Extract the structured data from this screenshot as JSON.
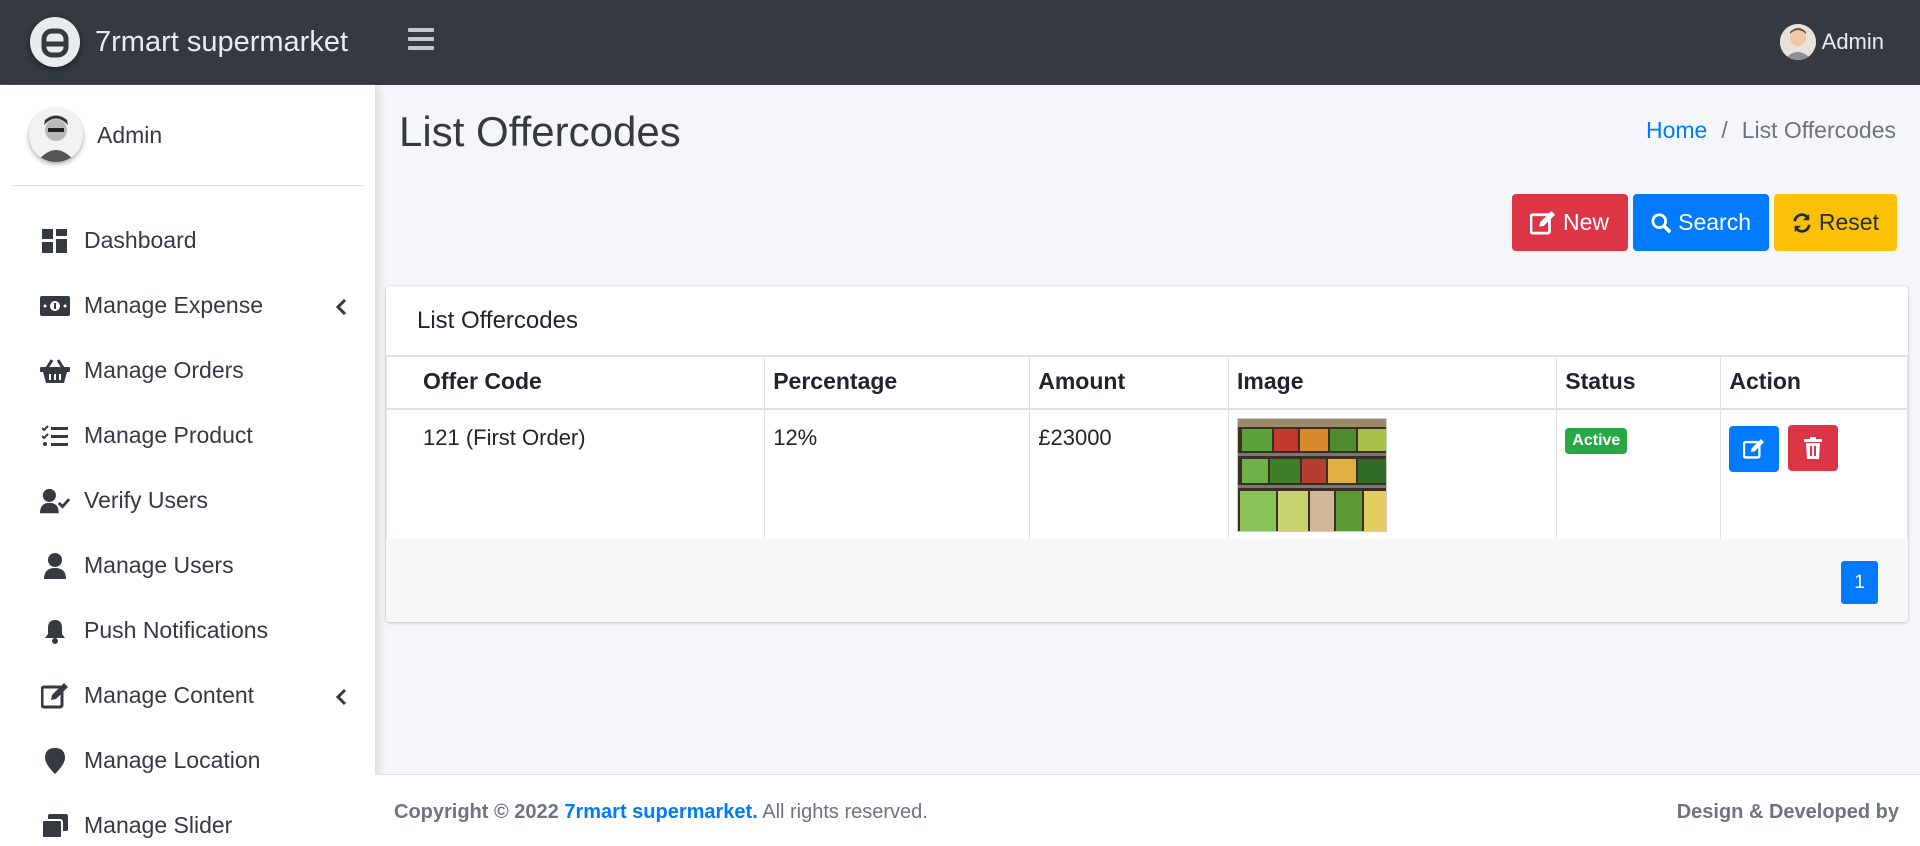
{
  "brand": {
    "name": "7rmart supermarket"
  },
  "topbar": {
    "user": "Admin"
  },
  "sidebar": {
    "user": "Admin",
    "items": [
      {
        "label": "Dashboard",
        "icon": "dashboard-icon"
      },
      {
        "label": "Manage Expense",
        "icon": "money-icon"
      },
      {
        "label": "Manage Orders",
        "icon": "basket-icon"
      },
      {
        "label": "Manage Product",
        "icon": "list-check-icon"
      },
      {
        "label": "Verify Users",
        "icon": "user-check-icon"
      },
      {
        "label": "Manage Users",
        "icon": "user-icon"
      },
      {
        "label": "Push Notifications",
        "icon": "bell-icon"
      },
      {
        "label": "Manage Content",
        "icon": "edit-icon"
      },
      {
        "label": "Manage Location",
        "icon": "map-marker-icon"
      },
      {
        "label": "Manage Slider",
        "icon": "images-icon"
      }
    ]
  },
  "page": {
    "title": "List Offercodes",
    "breadcrumb": {
      "home": "Home",
      "sep": "/",
      "current": "List Offercodes"
    }
  },
  "buttons": {
    "new": "New",
    "search": "Search",
    "reset": "Reset"
  },
  "card": {
    "title": "List Offercodes",
    "columns": [
      "Offer Code",
      "Percentage",
      "Amount",
      "Image",
      "Status",
      "Action"
    ],
    "rows": [
      {
        "offer_code": "121 (First Order)",
        "percentage": "12%",
        "amount": "£23000",
        "status": "Active"
      }
    ],
    "pagination": {
      "current": "1"
    }
  },
  "footer": {
    "copyright_prefix": "Copyright © 2022",
    "brand": "7rmart supermarket.",
    "rights": "All rights reserved.",
    "right": "Design & Developed by"
  },
  "colors": {
    "topbar": "#343a40",
    "primary": "#007bff",
    "danger": "#dc3545",
    "warning": "#ffc107",
    "success": "#28a745"
  }
}
